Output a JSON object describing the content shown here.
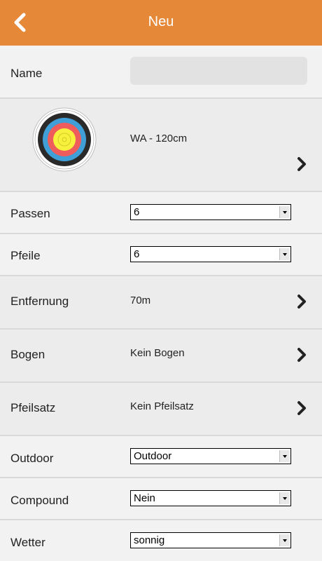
{
  "header": {
    "title": "Neu",
    "back_icon": "chevron-left-icon"
  },
  "colors": {
    "header_bg": "#e58837",
    "row_bg": "#f2f2f2",
    "row_alt_bg": "#ececec"
  },
  "form": {
    "name": {
      "label": "Name",
      "value": ""
    },
    "target": {
      "value": "WA - 120cm",
      "icon": "archery-target-icon"
    },
    "passen": {
      "label": "Passen",
      "value": "6"
    },
    "pfeile": {
      "label": "Pfeile",
      "value": "6"
    },
    "entfernung": {
      "label": "Entfernung",
      "value": "70m"
    },
    "bogen": {
      "label": "Bogen",
      "value": "Kein Bogen"
    },
    "pfeilsatz": {
      "label": "Pfeilsatz",
      "value": "Kein Pfeilsatz"
    },
    "outdoor": {
      "label": "Outdoor",
      "value": "Outdoor"
    },
    "compound": {
      "label": "Compound",
      "value": "Nein"
    },
    "wetter": {
      "label": "Wetter",
      "value": "sonnig"
    }
  }
}
